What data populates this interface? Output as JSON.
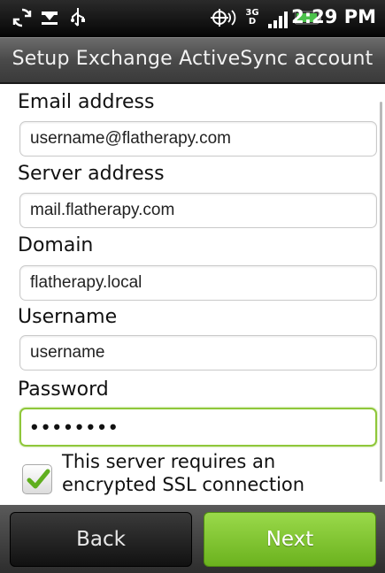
{
  "status_bar": {
    "time": "2:29 PM",
    "network_type_top": "3G",
    "network_type_bottom": "D",
    "icons": [
      "sync-icon",
      "notification-icon",
      "usb-icon",
      "gps-icon",
      "network-3g-icon",
      "signal-icon",
      "battery-icon"
    ]
  },
  "header": {
    "title": "Setup Exchange ActiveSync account"
  },
  "form": {
    "email": {
      "label": "Email address",
      "value": "username@flatherapy.com"
    },
    "server": {
      "label": "Server address",
      "value": "mail.flatherapy.com"
    },
    "domain": {
      "label": "Domain",
      "value": "flatherapy.local"
    },
    "username": {
      "label": "Username",
      "value": "username"
    },
    "password": {
      "label": "Password",
      "value": "••••••••"
    },
    "ssl": {
      "label": "This server requires an encrypted SSL connection",
      "checked": true
    }
  },
  "footer": {
    "back_label": "Back",
    "next_label": "Next"
  },
  "colors": {
    "accent_green": "#8fc73a",
    "next_button": "#7fc230",
    "title_bar": "#4a4a4a"
  }
}
